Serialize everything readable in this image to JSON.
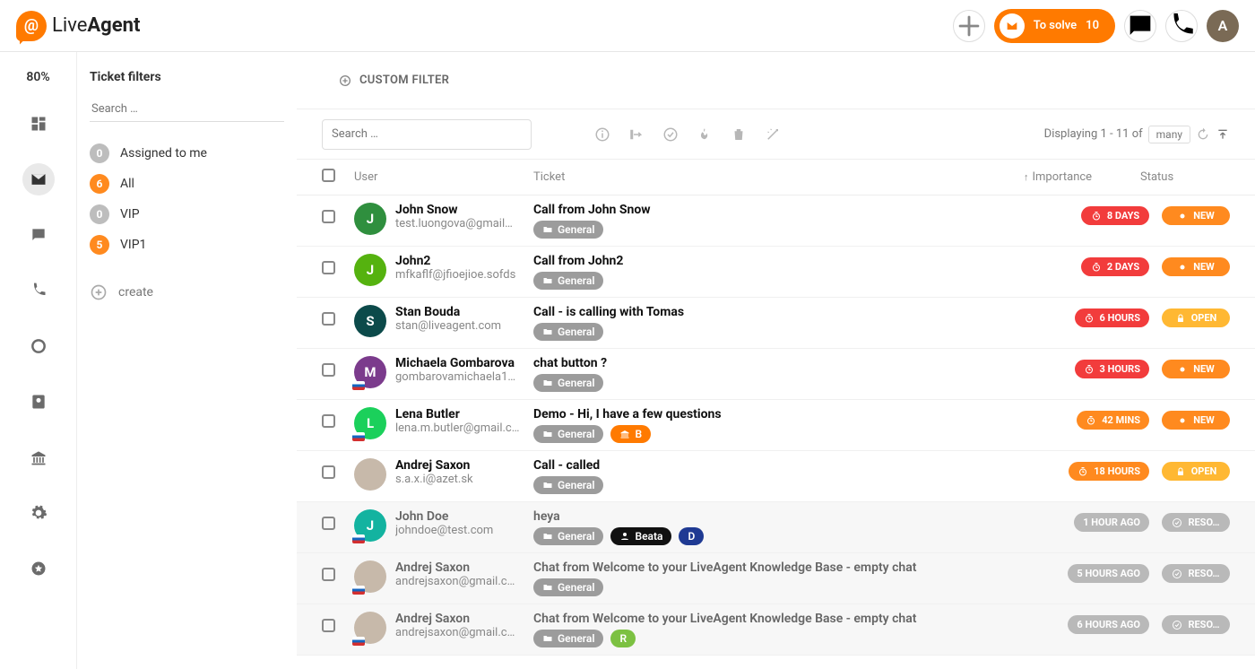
{
  "brand": {
    "live": "Live",
    "agent": "Agent",
    "logo_glyph": "@"
  },
  "topbar": {
    "to_solve_label": "To solve",
    "to_solve_count": "10",
    "avatar_letter": "A"
  },
  "rail": {
    "percent": "80%"
  },
  "filters_panel": {
    "title": "Ticket filters",
    "search_placeholder": "Search …",
    "create_label": "create",
    "items": [
      {
        "count": "0",
        "color": "grey",
        "label": "Assigned to me"
      },
      {
        "count": "6",
        "color": "orange",
        "label": "All"
      },
      {
        "count": "0",
        "color": "grey",
        "label": "VIP"
      },
      {
        "count": "5",
        "color": "orange",
        "label": "VIP1"
      }
    ]
  },
  "custom_filter_label": "CUSTOM FILTER",
  "toolbar": {
    "search_placeholder": "Search …",
    "displaying_prefix": "Displaying 1 - 11 of",
    "many": "many"
  },
  "columns": {
    "user": "User",
    "ticket": "Ticket",
    "importance": "Importance",
    "status": "Status"
  },
  "tickets": [
    {
      "avatar": {
        "letter": "J",
        "bg": "#2f8f3e"
      },
      "name": "John Snow",
      "email": "test.luongova@gmail…",
      "subject": "Call from John Snow",
      "tags": [
        {
          "label": "General",
          "style": "grey",
          "icon": "folder"
        }
      ],
      "importance": {
        "label": "8 DAYS",
        "style": "red",
        "icon": "clock"
      },
      "status": {
        "label": "NEW",
        "style": "orangeP",
        "icon": "dot"
      },
      "muted": false
    },
    {
      "avatar": {
        "letter": "J",
        "bg": "#55b20f"
      },
      "name": "John2",
      "email": "mfkaflf@jfioejioe.sofds",
      "subject": "Call from John2",
      "tags": [
        {
          "label": "General",
          "style": "grey",
          "icon": "folder"
        }
      ],
      "importance": {
        "label": "2 DAYS",
        "style": "red",
        "icon": "clock"
      },
      "status": {
        "label": "NEW",
        "style": "orangeP",
        "icon": "dot"
      },
      "muted": false
    },
    {
      "avatar": {
        "letter": "S",
        "bg": "#0c4a4a"
      },
      "name": "Stan Bouda",
      "email": "stan@liveagent.com",
      "subject": "Call - is calling with Tomas",
      "tags": [
        {
          "label": "General",
          "style": "grey",
          "icon": "folder"
        }
      ],
      "importance": {
        "label": "6 HOURS",
        "style": "red",
        "icon": "clock"
      },
      "status": {
        "label": "OPEN",
        "style": "yellow",
        "icon": "lock"
      },
      "muted": false
    },
    {
      "avatar": {
        "letter": "M",
        "bg": "#7b3b8c",
        "flag": true
      },
      "name": "Michaela Gombarova",
      "email": "gombarovamichaela1…",
      "subject": "chat button ?",
      "tags": [
        {
          "label": "General",
          "style": "grey",
          "icon": "folder"
        }
      ],
      "importance": {
        "label": "3 HOURS",
        "style": "red",
        "icon": "clock"
      },
      "status": {
        "label": "NEW",
        "style": "orangeP",
        "icon": "dot"
      },
      "muted": false
    },
    {
      "avatar": {
        "letter": "L",
        "bg": "#1bd05b",
        "flag": true
      },
      "name": "Lena Butler",
      "email": "lena.m.butler@gmail.c…",
      "subject": "Demo - Hi, I have a few questions",
      "tags": [
        {
          "label": "General",
          "style": "grey",
          "icon": "folder"
        },
        {
          "label": "B",
          "style": "orange",
          "icon": "bank"
        }
      ],
      "importance": {
        "label": "42 MINS",
        "style": "orangeP",
        "icon": "clock"
      },
      "status": {
        "label": "NEW",
        "style": "orangeP",
        "icon": "dot"
      },
      "muted": false
    },
    {
      "avatar": {
        "letter": "",
        "bg": "",
        "img": true
      },
      "name": "Andrej Saxon",
      "email": "s.a.x.i@azet.sk",
      "subject": "Call - called",
      "tags": [
        {
          "label": "General",
          "style": "grey",
          "icon": "folder"
        }
      ],
      "importance": {
        "label": "18 HOURS",
        "style": "orangeP",
        "icon": "clock"
      },
      "status": {
        "label": "OPEN",
        "style": "yellow",
        "icon": "lock"
      },
      "muted": false
    },
    {
      "avatar": {
        "letter": "J",
        "bg": "#13b3a0",
        "flag": true
      },
      "name": "John Doe",
      "email": "johndoe@test.com",
      "subject": "heya",
      "tags": [
        {
          "label": "General",
          "style": "grey",
          "icon": "folder"
        },
        {
          "label": "Beata",
          "style": "black",
          "icon": "user"
        },
        {
          "label": "D",
          "style": "blue",
          "icon": ""
        }
      ],
      "importance": {
        "label": "1 HOUR AGO",
        "style": "greyP",
        "icon": ""
      },
      "status": {
        "label": "RESO…",
        "style": "greyP",
        "icon": "check"
      },
      "muted": true
    },
    {
      "avatar": {
        "letter": "",
        "bg": "",
        "img": true,
        "flag": true
      },
      "name": "Andrej Saxon",
      "email": "andrejsaxon@gmail.c…",
      "subject": "Chat from Welcome to your LiveAgent Knowledge Base - empty chat",
      "tags": [
        {
          "label": "General",
          "style": "grey",
          "icon": "folder"
        }
      ],
      "importance": {
        "label": "5 HOURS AGO",
        "style": "greyP",
        "icon": ""
      },
      "status": {
        "label": "RESO…",
        "style": "greyP",
        "icon": "check"
      },
      "muted": true
    },
    {
      "avatar": {
        "letter": "",
        "bg": "",
        "img": true,
        "flag": true
      },
      "name": "Andrej Saxon",
      "email": "andrejsaxon@gmail.c…",
      "subject": "Chat from Welcome to your LiveAgent Knowledge Base - empty chat",
      "tags": [
        {
          "label": "General",
          "style": "grey",
          "icon": "folder"
        },
        {
          "label": "R",
          "style": "green",
          "icon": ""
        }
      ],
      "importance": {
        "label": "6 HOURS AGO",
        "style": "greyP",
        "icon": ""
      },
      "status": {
        "label": "RESO…",
        "style": "greyP",
        "icon": "check"
      },
      "muted": true
    }
  ]
}
